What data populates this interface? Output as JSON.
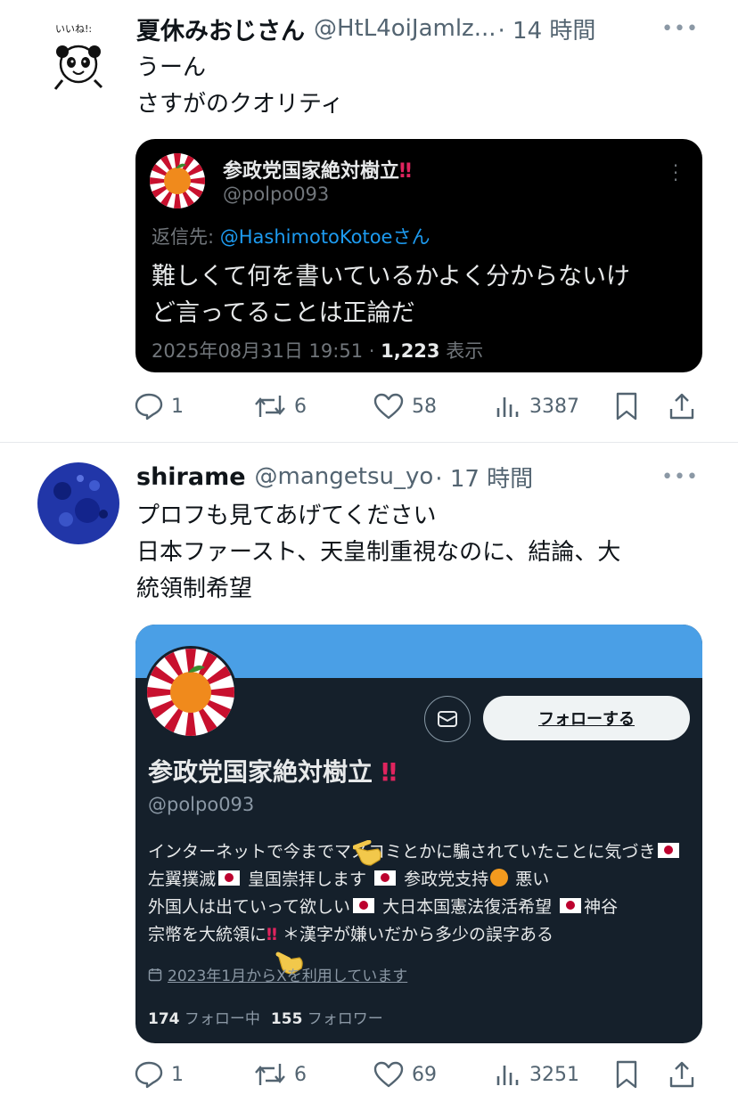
{
  "posts": [
    {
      "author": {
        "name": "夏休みおじさん",
        "handle": "@HtL4oiJamlz...",
        "time": "· 14 時間",
        "avatar_text": "いいね!:"
      },
      "text_lines": [
        "うーん",
        "さすがのクオリティ"
      ],
      "quote": {
        "name": "参政党国家絶対樹立",
        "name_emoji": "‼",
        "handle": "@polpo093",
        "reply_prefix": "返信先: ",
        "reply_to": "@HashimotoKotoeさん",
        "text_lines": [
          "難しくて何を書いているかよく分からないけ",
          "ど言ってることは正論だ"
        ],
        "date": "2025年08月31日 19:51 · ",
        "views_count": "1,223",
        "views_label": " 表示"
      },
      "actions": {
        "replies": "1",
        "reposts": "6",
        "likes": "58",
        "views": "3387"
      }
    },
    {
      "author": {
        "name": "shirame",
        "handle": "@mangetsu_yo",
        "time": "· 17 時間"
      },
      "text_lines": [
        "プロフも見てあげてください",
        "日本ファースト、天皇制重視なのに、結論、大",
        "統領制希望"
      ],
      "profile_card": {
        "name": "参政党国家絶対樹立",
        "name_emoji": "‼",
        "handle": "@polpo093",
        "follow_label": "フォローする",
        "bio": {
          "s1": "インターネットで今までマスコミとかに騙されていたことに気",
          "s2": "づき",
          "s3": " 左翼撲滅",
          "s4": " 皇国崇拝します ",
          "s5": " 参政党支持",
          "s6": " 悪い",
          "s7": "外国人は出ていって欲しい",
          "s8": " 大日本国憲法復活希望 ",
          "s9": "神谷",
          "s10": "宗幣を大統領に",
          "s11": "‼",
          "s12": " ＊漢字が嫌いだから多少の誤字ある"
        },
        "joined": "2023年1月からXを利用しています",
        "following_count": "174",
        "following_label": " フォロー中",
        "followers_count": "155",
        "followers_label": " フォロワー"
      },
      "actions": {
        "replies": "1",
        "reposts": "6",
        "likes": "69",
        "views": "3251"
      }
    }
  ],
  "icons": [
    "reply-icon",
    "repost-icon",
    "like-icon",
    "views-icon",
    "bookmark-icon",
    "share-icon",
    "more-icon",
    "mail-icon",
    "calendar-icon"
  ]
}
